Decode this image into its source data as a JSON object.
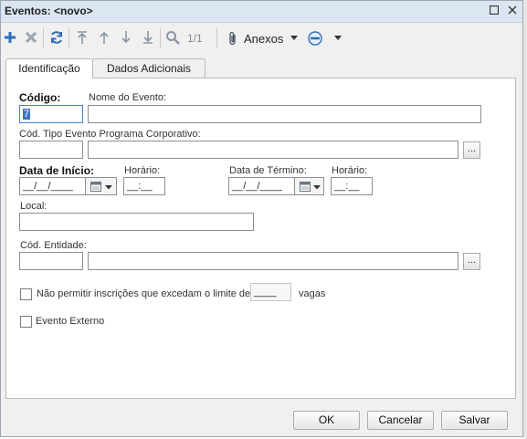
{
  "window": {
    "title": "Eventos: <novo>"
  },
  "toolbar": {
    "add_icon": "plus-icon",
    "delete_icon": "x-icon",
    "refresh_icon": "refresh-icon",
    "first_icon": "arrow-first-icon",
    "prev_icon": "arrow-up-icon",
    "next_icon": "arrow-down-icon",
    "last_icon": "arrow-last-icon",
    "search_icon": "magnifier-icon",
    "record_counter": "1/1",
    "attachments_label": "Anexos"
  },
  "tabs": [
    {
      "label": "Identificação",
      "active": true
    },
    {
      "label": "Dados Adicionais",
      "active": false
    }
  ],
  "form": {
    "codigo": {
      "label": "Código:",
      "value": "7"
    },
    "nome_evento": {
      "label": "Nome do Evento:",
      "value": ""
    },
    "cod_tipo_evento": {
      "label": "Cód. Tipo Evento Programa Corporativo:",
      "value": ""
    },
    "data_inicio": {
      "label": "Data de Início:",
      "value": "__/__/____"
    },
    "horario_inicio": {
      "label": "Horário:",
      "value": "__:__"
    },
    "data_termino": {
      "label": "Data de Término:",
      "value": "__/__/____"
    },
    "horario_termino": {
      "label": "Horário:",
      "value": "__:__"
    },
    "local": {
      "label": "Local:",
      "value": ""
    },
    "cod_entidade": {
      "label": "Cód. Entidade:",
      "value": ""
    },
    "limite": {
      "label": "Não permitir inscrições que excedam o limite de",
      "value": "____",
      "suffix": "vagas",
      "checked": false
    },
    "evento_externo": {
      "label": "Evento Externo",
      "checked": false
    },
    "lookup_label": "..."
  },
  "buttons": {
    "ok": "OK",
    "cancel": "Cancelar",
    "save": "Salvar"
  },
  "colors": {
    "titlebar": "#dce6f2",
    "focus": "#4a7fc7",
    "accent_icon": "#2f6fb7"
  }
}
